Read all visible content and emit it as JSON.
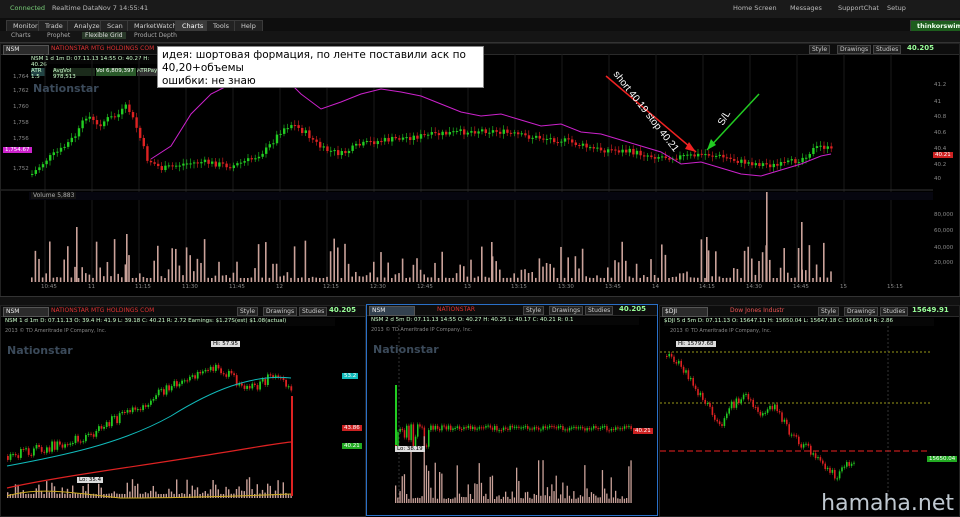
{
  "topbar": {
    "connected": "Connected",
    "realtime": "Realtime Data",
    "datetime": "Nov 7  14:55:41",
    "home": "Home Screen",
    "messages": "Messages",
    "support": "SupportChat",
    "setup": "Setup",
    "brand": "thinkorswim"
  },
  "tabs": [
    "Monitor",
    "Trade",
    "Analyze",
    "Scan",
    "MarketWatch",
    "Charts",
    "Tools",
    "Help"
  ],
  "active_tab": "Charts",
  "subtabs": [
    "Charts",
    "Prophet",
    "Flexible Grid",
    "Product Depth"
  ],
  "main": {
    "symbol": "NSM",
    "company": "NATIONSTAR MTG HOLDINGS COM",
    "info": "NSM 1 d 1m  D: 07.11.13 14:55  O: 40.27  H: 40.26",
    "studies_row": [
      "ATR 1.5",
      "AvgVol 978,513",
      "Vol 6,809,397",
      "ATRPay"
    ],
    "price": "40.205",
    "buttons": [
      "Style",
      "Drawings",
      "Studies"
    ],
    "left_price_tag": "1,754.67",
    "right_price_tag": "40.21",
    "left_axis": [
      "1,764",
      "1,762",
      "1,760",
      "1,758",
      "1,756",
      "1,752"
    ],
    "right_axis": [
      "41.2",
      "41",
      "40.8",
      "40.6",
      "40.4",
      "40.2",
      "40"
    ],
    "volume_label": "Volume 5,883",
    "volume_axis": [
      "80,000",
      "60,000",
      "40,000",
      "20,000"
    ],
    "time_axis": [
      "10:45",
      "11",
      "11:15",
      "11:30",
      "11:45",
      "12",
      "12:15",
      "12:30",
      "12:45",
      "13",
      "13:15",
      "13:30",
      "13:45",
      "14",
      "14:15",
      "14:30",
      "14:45",
      "15",
      "15:15"
    ],
    "annotation_short": "short 40.19 stop 40.21",
    "annotation_sl": "S/L",
    "note_line1": "идея: шортовая формация, по ленте поставили аск по 40,20+объемы",
    "note_line2": "ошибки: не знаю",
    "watermark": "Nationstar"
  },
  "bottom_left": {
    "symbol": "NSM",
    "company": "NATIONSTAR MTG HOLDINGS COM",
    "price": "40.205",
    "info": "NSM 1 d 1m  D: 07.11.13  O: 39.4  H: 41.9  L: 39.18  C: 40.21  R: 2.72  Earnings: $1.27S(est) $1.08(actual)",
    "copyright": "2013 © TD Ameritrade IP Company, Inc.",
    "hi_label": "Hi: 57.95",
    "lo_label": "Lo: 35.4",
    "right_tags": [
      "53.2",
      "43.86",
      "40.21"
    ],
    "axis": [
      "60",
      "55",
      "50",
      "45",
      "40",
      "35"
    ],
    "months": [
      "Mar",
      "Apr",
      "May",
      "Jun",
      "Jul",
      "Aug",
      "Sep",
      "Oct",
      "Nov",
      "Dec"
    ]
  },
  "bottom_mid": {
    "symbol": "NSM",
    "company": "NATIONSTAR",
    "price": "40.205",
    "info": "NSM 2 d 5m  D: 07.11.13 14:55  O: 40.27  H: 40.25  L: 40.17  C: 40.21  R: 0.1",
    "copyright": "2013 © TD Ameritrade IP Company, Inc.",
    "lo_label": "Lo: 38.19",
    "tag": "40.21",
    "axis": [
      "48",
      "46",
      "44",
      "42",
      "40",
      "38"
    ],
    "times": [
      "12:30",
      "14",
      "10:30",
      "11:30",
      "12:30",
      "13:30",
      "14:30"
    ]
  },
  "bottom_right": {
    "symbol": "$DJI",
    "company": "Dow Jones Industr",
    "price": "15649.91",
    "info": "$DJI 5 d 5m  D: 07.11.13  O: 15647.11  H: 15650.04  L: 15647.18  C: 15650.04  R: 2.86",
    "copyright": "2013 © TD Ameritrade IP Company, Inc.",
    "hi_label": "Hi: 15797.68",
    "tag": "15650.04",
    "axis": [
      "15800",
      "15760",
      "15720",
      "15680",
      "15640",
      "15600",
      "15560"
    ],
    "times": [
      "10:00",
      "11:00",
      "12:00",
      "13:00",
      "14:00",
      "15:00"
    ]
  },
  "site_watermark": "hamaha.net",
  "colors": {
    "up": "#22cc22",
    "down": "#dd2222",
    "volume": "#caa29a",
    "magenta": "#cc22cc",
    "panel_border": "#2a70c8"
  }
}
